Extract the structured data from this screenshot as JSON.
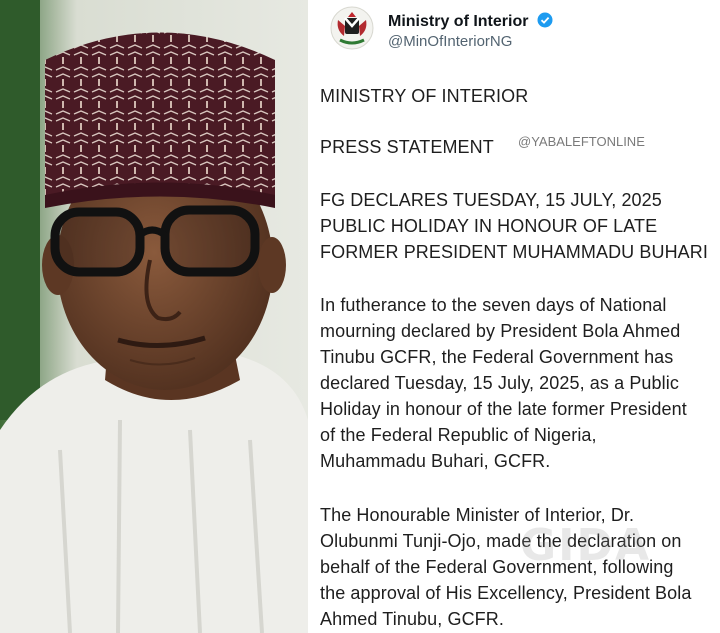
{
  "account": {
    "name": "Ministry of Interior",
    "handle": "@MinOfInteriorNG",
    "verified": true
  },
  "watermark": "@YABALEFTONLINE",
  "overlay_mark": "GIDA",
  "statement": {
    "org": "MINISTRY OF INTERIOR",
    "type": "PRESS STATEMENT",
    "headline": [
      "FG DECLARES TUESDAY, 15 JULY, 2025",
      "PUBLIC HOLIDAY IN HONOUR OF LATE",
      "FORMER PRESIDENT MUHAMMADU BUHARI"
    ],
    "paragraph1": [
      "In futherance to the seven days of National",
      "mourning declared by President Bola Ahmed",
      "Tinubu GCFR, the Federal Government has",
      "declared Tuesday, 15 July, 2025, as a Public",
      "Holiday in honour of the late former President",
      "of the Federal Republic of Nigeria,",
      "Muhammadu Buhari, GCFR."
    ],
    "paragraph2": [
      "The Honourable Minister of Interior, Dr.",
      "Olubunmi Tunji-Ojo, made the declaration on",
      "behalf of the Federal Government, following",
      "the approval of His Excellency, President Bola",
      "Ahmed Tinubu, GCFR."
    ]
  },
  "colors": {
    "verified_blue": "#1d9bf0",
    "cap_maroon": "#4a1a24",
    "robe_white": "#eeeeea",
    "backdrop_green": "#2f5b2b"
  }
}
